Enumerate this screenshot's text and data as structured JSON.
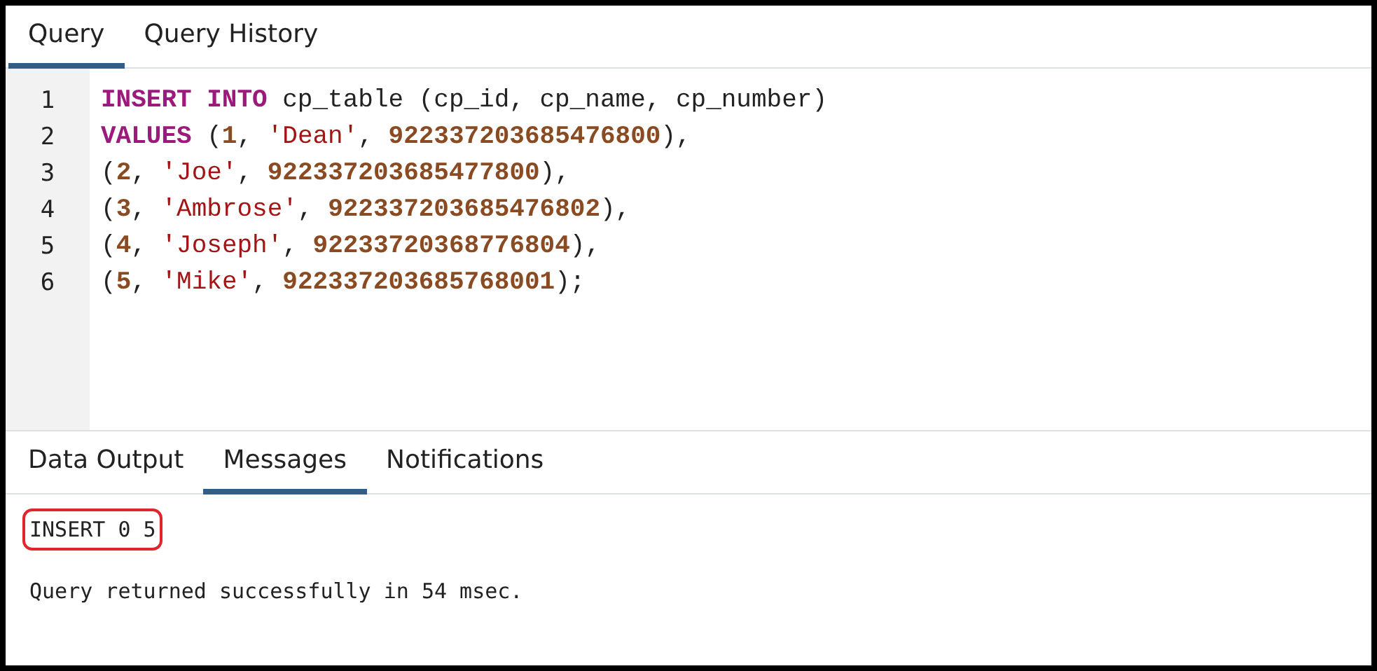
{
  "query_tabs": [
    {
      "label": "Query",
      "selected": true
    },
    {
      "label": "Query History",
      "selected": false
    }
  ],
  "editor": {
    "lines": [
      {
        "number": "1",
        "tokens": [
          {
            "kind": "keyword",
            "text": "INSERT INTO"
          },
          {
            "kind": "plain",
            "text": " cp_table (cp_id, cp_name, cp_number)"
          }
        ]
      },
      {
        "number": "2",
        "tokens": [
          {
            "kind": "keyword",
            "text": "VALUES"
          },
          {
            "kind": "plain",
            "text": " ("
          },
          {
            "kind": "number",
            "text": "1"
          },
          {
            "kind": "plain",
            "text": ", "
          },
          {
            "kind": "string",
            "text": "'Dean'"
          },
          {
            "kind": "plain",
            "text": ", "
          },
          {
            "kind": "number",
            "text": "922337203685476800"
          },
          {
            "kind": "plain",
            "text": "),"
          }
        ]
      },
      {
        "number": "3",
        "tokens": [
          {
            "kind": "plain",
            "text": "("
          },
          {
            "kind": "number",
            "text": "2"
          },
          {
            "kind": "plain",
            "text": ", "
          },
          {
            "kind": "string",
            "text": "'Joe'"
          },
          {
            "kind": "plain",
            "text": ", "
          },
          {
            "kind": "number",
            "text": "922337203685477800"
          },
          {
            "kind": "plain",
            "text": "),"
          }
        ]
      },
      {
        "number": "4",
        "tokens": [
          {
            "kind": "plain",
            "text": "("
          },
          {
            "kind": "number",
            "text": "3"
          },
          {
            "kind": "plain",
            "text": ", "
          },
          {
            "kind": "string",
            "text": "'Ambrose'"
          },
          {
            "kind": "plain",
            "text": ", "
          },
          {
            "kind": "number",
            "text": "922337203685476802"
          },
          {
            "kind": "plain",
            "text": "),"
          }
        ]
      },
      {
        "number": "5",
        "tokens": [
          {
            "kind": "plain",
            "text": "("
          },
          {
            "kind": "number",
            "text": "4"
          },
          {
            "kind": "plain",
            "text": ", "
          },
          {
            "kind": "string",
            "text": "'Joseph'"
          },
          {
            "kind": "plain",
            "text": ", "
          },
          {
            "kind": "number",
            "text": "92233720368776804"
          },
          {
            "kind": "plain",
            "text": "),"
          }
        ]
      },
      {
        "number": "6",
        "tokens": [
          {
            "kind": "plain",
            "text": "("
          },
          {
            "kind": "number",
            "text": "5"
          },
          {
            "kind": "plain",
            "text": ", "
          },
          {
            "kind": "string",
            "text": "'Mike'"
          },
          {
            "kind": "plain",
            "text": ", "
          },
          {
            "kind": "number",
            "text": "922337203685768001"
          },
          {
            "kind": "plain",
            "text": ");"
          }
        ]
      }
    ]
  },
  "output_tabs": [
    {
      "label": "Data Output",
      "selected": false
    },
    {
      "label": "Messages",
      "selected": true
    },
    {
      "label": "Notifications",
      "selected": false
    }
  ],
  "messages": [
    {
      "text": "INSERT 0 5",
      "highlighted": true
    },
    {
      "text": "Query returned successfully in 54 msec.",
      "highlighted": false
    }
  ]
}
